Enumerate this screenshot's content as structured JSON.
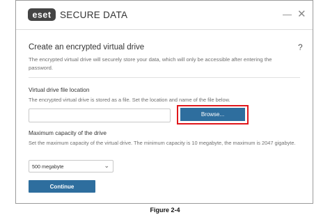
{
  "app": {
    "logo_text": "eset",
    "title": "SECURE DATA",
    "brand_color": "#2e6e9e",
    "logo_bg": "#444444"
  },
  "window_controls": {
    "minimize_icon": "minimize-icon",
    "close_icon": "close-icon"
  },
  "main": {
    "heading": "Create an encrypted virtual drive",
    "help": "?",
    "description": "The encrypted virtual drive will securely store your data, which will only be accessible after entering the password."
  },
  "file_location": {
    "label": "Virtual drive file location",
    "description": "The encrypted virtual drive is stored as a file. Set the location and name of the file below.",
    "input_value": "",
    "browse_label": "Browse...",
    "highlight_color": "#e0161b"
  },
  "capacity": {
    "label": "Maximum capacity of the drive",
    "description": "Set the maximum capacity of the virtual drive. The minimum capacity is 10 megabyte, the maximum is 2047 gigabyte.",
    "selected_value": "500 megabyte"
  },
  "actions": {
    "continue_label": "Continue"
  },
  "caption": "Figure 2-4"
}
